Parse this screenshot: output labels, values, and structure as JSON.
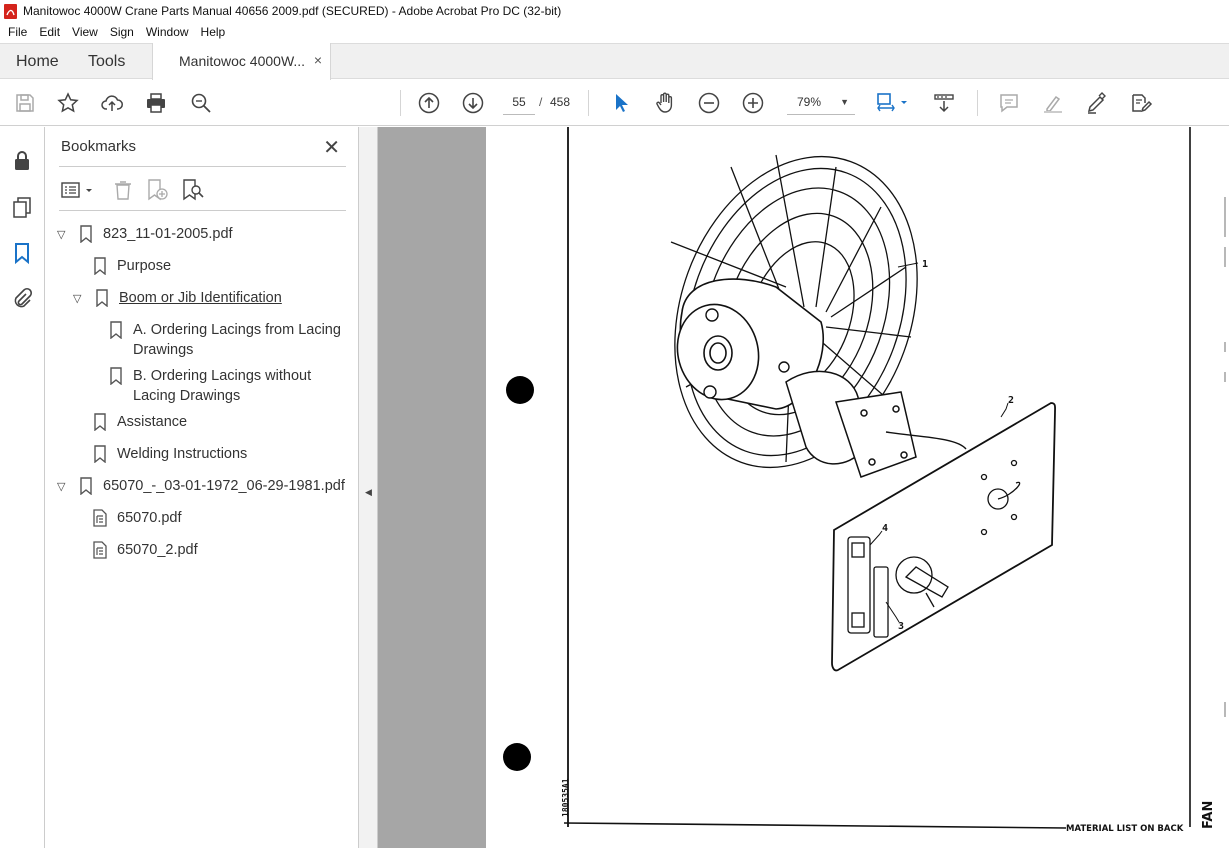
{
  "window": {
    "title": "Manitowoc 4000W Crane Parts Manual 40656 2009.pdf (SECURED) - Adobe Acrobat Pro DC (32-bit)"
  },
  "menu": [
    "File",
    "Edit",
    "View",
    "Sign",
    "Window",
    "Help"
  ],
  "tabs": {
    "home": "Home",
    "tools": "Tools",
    "doc": "Manitowoc 4000W...",
    "close": "×"
  },
  "toolbar": {
    "page_current": "55",
    "page_sep": "/",
    "page_total": "458",
    "zoom": "79%"
  },
  "bookmarks": {
    "title": "Bookmarks",
    "close": "✕",
    "items": [
      {
        "label": "823_11-01-2005.pdf",
        "level": 0,
        "expanded": true
      },
      {
        "label": "Purpose",
        "level": 1
      },
      {
        "label": "Boom or Jib Identification",
        "level": 1,
        "expanded": true,
        "active": true
      },
      {
        "label": "A. Ordering Lacings from Lacing Drawings",
        "level": 2
      },
      {
        "label": "B. Ordering Lacings without Lacing Drawings",
        "level": 2
      },
      {
        "label": "Assistance",
        "level": 1
      },
      {
        "label": "Welding Instructions",
        "level": 1
      },
      {
        "label": "65070_-_03-01-1972_06-29-1981.pdf",
        "level": 0,
        "expanded": true
      },
      {
        "label": "65070.pdf",
        "level": 1
      },
      {
        "label": "65070_2.pdf",
        "level": 1
      }
    ]
  },
  "page": {
    "callouts": [
      "1",
      "2",
      "3",
      "4"
    ],
    "figure_code": "180535A1",
    "footer_note": "MATERIAL LIST ON BACK",
    "side_title": "FAN"
  }
}
